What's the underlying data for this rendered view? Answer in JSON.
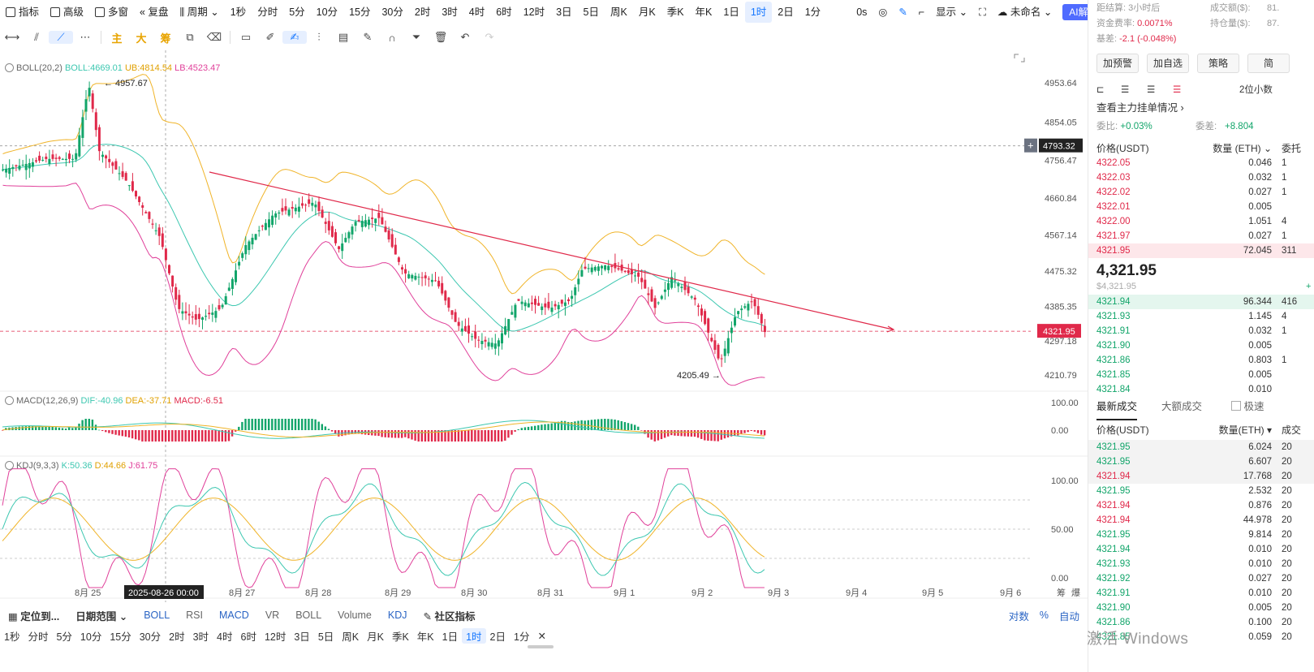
{
  "toolbar": {
    "indicators": "指标",
    "advanced": "高级",
    "multi_window": "多窗",
    "replay": "复盘",
    "period": "周期",
    "intervals": [
      "1秒",
      "分时",
      "5分",
      "10分",
      "15分",
      "30分",
      "2时",
      "3时",
      "4时",
      "6时",
      "12时",
      "3日",
      "5日",
      "周K",
      "月K",
      "季K",
      "年K",
      "1日",
      "1时",
      "2日",
      "1分"
    ],
    "active_interval": "1时",
    "seconds": "0s",
    "display": "显示",
    "unnamed": "未命名",
    "ai_read": "AI解读"
  },
  "drawbar": {
    "main": "主",
    "big": "大",
    "chip": "筹"
  },
  "boll_legend": {
    "name": "BOLL(20,2)",
    "boll": "BOLL:4669.01",
    "ub": "UB:4814.54",
    "lb": "LB:4523.47"
  },
  "macd_legend": {
    "name": "MACD(12,26,9)",
    "dif": "DIF:-40.96",
    "dea": "DEA:-37.71",
    "macd": "MACD:-6.51"
  },
  "kdj_legend": {
    "name": "KDJ(9,3,3)",
    "k": "K:50.36",
    "d": "D:44.66",
    "j": "J:61.75"
  },
  "price_axis": [
    "4953.64",
    "4854.05",
    "4756.47",
    "4660.84",
    "4567.14",
    "4475.32",
    "4385.35",
    "4297.18",
    "4210.79"
  ],
  "crosshair_price": "4793.32",
  "last_price_label": "4321.95",
  "high_label": "4957.67",
  "low_label": "4205.49",
  "macd_axis": [
    "100.00",
    "0.00"
  ],
  "kdj_axis": [
    "100.00",
    "50.00",
    "0.00"
  ],
  "time_axis": [
    "8月 25",
    "8月 27",
    "8月 28",
    "8月 29",
    "8月 30",
    "8月 31",
    "9月 1",
    "9月 2",
    "9月 3",
    "9月 4",
    "9月 5",
    "9月 6"
  ],
  "crosshair_time": "2025-08-26 00:00",
  "axis_corner": [
    "筹",
    "爆"
  ],
  "bottom_bar": {
    "locate": "定位到...",
    "date_range": "日期范围",
    "boll": "BOLL",
    "rsi": "RSI",
    "macd": "MACD",
    "vr": "VR",
    "boll2": "BOLL",
    "volume": "Volume",
    "kdj": "KDJ",
    "community": "社区指标",
    "log": "对数",
    "percent": "%",
    "auto": "自动"
  },
  "bottom_intervals": [
    "1秒",
    "分时",
    "5分",
    "10分",
    "15分",
    "30分",
    "2时",
    "3时",
    "4时",
    "6时",
    "12时",
    "3日",
    "5日",
    "周K",
    "月K",
    "季K",
    "年K",
    "1日",
    "1时",
    "2日",
    "1分"
  ],
  "sidebar": {
    "settle_label": "距结算:",
    "settle_val": "3小时后",
    "turnover_label": "成交额($):",
    "turnover_val": "81.",
    "funding_label": "资金费率:",
    "funding_val": "0.0071%",
    "oi_label": "持仓量($):",
    "oi_val": "87.",
    "basis_label": "基差:",
    "basis_val": "-2.1 (-0.048%)",
    "btn_alert": "加预警",
    "btn_watch": "加自选",
    "btn_strategy": "策略",
    "btn_more": "简",
    "decimals": "2位小数",
    "main_orders": "查看主力挂单情况",
    "ratio_label": "委比:",
    "ratio_val": "+0.03%",
    "diff_label": "委差:",
    "diff_val": "+8.804",
    "hdr_price": "价格(USDT)",
    "hdr_qty": "数量 (ETH)",
    "hdr_total": "委托",
    "asks": [
      {
        "p": "4322.05",
        "q": "0.046",
        "t": "1"
      },
      {
        "p": "4322.03",
        "q": "0.032",
        "t": "1"
      },
      {
        "p": "4322.02",
        "q": "0.027",
        "t": "1"
      },
      {
        "p": "4322.01",
        "q": "0.005",
        "t": ""
      },
      {
        "p": "4322.00",
        "q": "1.051",
        "t": "4"
      },
      {
        "p": "4321.97",
        "q": "0.027",
        "t": "1"
      },
      {
        "p": "4321.95",
        "q": "72.045",
        "t": "311"
      }
    ],
    "mid_price": "4,321.95",
    "mid_usd": "$4,321.95",
    "mid_side": "+",
    "bids": [
      {
        "p": "4321.94",
        "q": "96.344",
        "t": "416"
      },
      {
        "p": "4321.93",
        "q": "1.145",
        "t": "4"
      },
      {
        "p": "4321.91",
        "q": "0.032",
        "t": "1"
      },
      {
        "p": "4321.90",
        "q": "0.005",
        "t": ""
      },
      {
        "p": "4321.86",
        "q": "0.803",
        "t": "1"
      },
      {
        "p": "4321.85",
        "q": "0.005",
        "t": ""
      },
      {
        "p": "4321.84",
        "q": "0.010",
        "t": ""
      }
    ],
    "tab_latest": "最新成交",
    "tab_large": "大额成交",
    "fast": "极速",
    "trade_hdr_price": "价格(USDT)",
    "trade_hdr_qty": "数量(ETH)",
    "trade_hdr_time": "成交",
    "trades": [
      {
        "p": "4321.95",
        "q": "6.024",
        "t": "20",
        "s": "buy"
      },
      {
        "p": "4321.95",
        "q": "6.607",
        "t": "20",
        "s": "buy"
      },
      {
        "p": "4321.94",
        "q": "17.768",
        "t": "20",
        "s": "sell"
      },
      {
        "p": "4321.95",
        "q": "2.532",
        "t": "20",
        "s": "buy"
      },
      {
        "p": "4321.94",
        "q": "0.876",
        "t": "20",
        "s": "sell"
      },
      {
        "p": "4321.94",
        "q": "44.978",
        "t": "20",
        "s": "sell"
      },
      {
        "p": "4321.95",
        "q": "9.814",
        "t": "20",
        "s": "buy"
      },
      {
        "p": "4321.94",
        "q": "0.010",
        "t": "20",
        "s": "buy"
      },
      {
        "p": "4321.93",
        "q": "0.010",
        "t": "20",
        "s": "buy"
      },
      {
        "p": "4321.92",
        "q": "0.027",
        "t": "20",
        "s": "buy"
      },
      {
        "p": "4321.91",
        "q": "0.010",
        "t": "20",
        "s": "buy"
      },
      {
        "p": "4321.90",
        "q": "0.005",
        "t": "20",
        "s": "buy"
      },
      {
        "p": "4321.86",
        "q": "0.100",
        "t": "20",
        "s": "buy"
      },
      {
        "p": "4321.85",
        "q": "0.059",
        "t": "20",
        "s": "buy"
      }
    ]
  },
  "watermark": "激活 Windows",
  "colors": {
    "up": "#12a56a",
    "down": "#e0294a",
    "boll_mid": "#3cc7b0",
    "boll_ub": "#f0b429",
    "boll_lb": "#e0409a",
    "trend": "#e0294a",
    "accent": "#1677ff"
  }
}
